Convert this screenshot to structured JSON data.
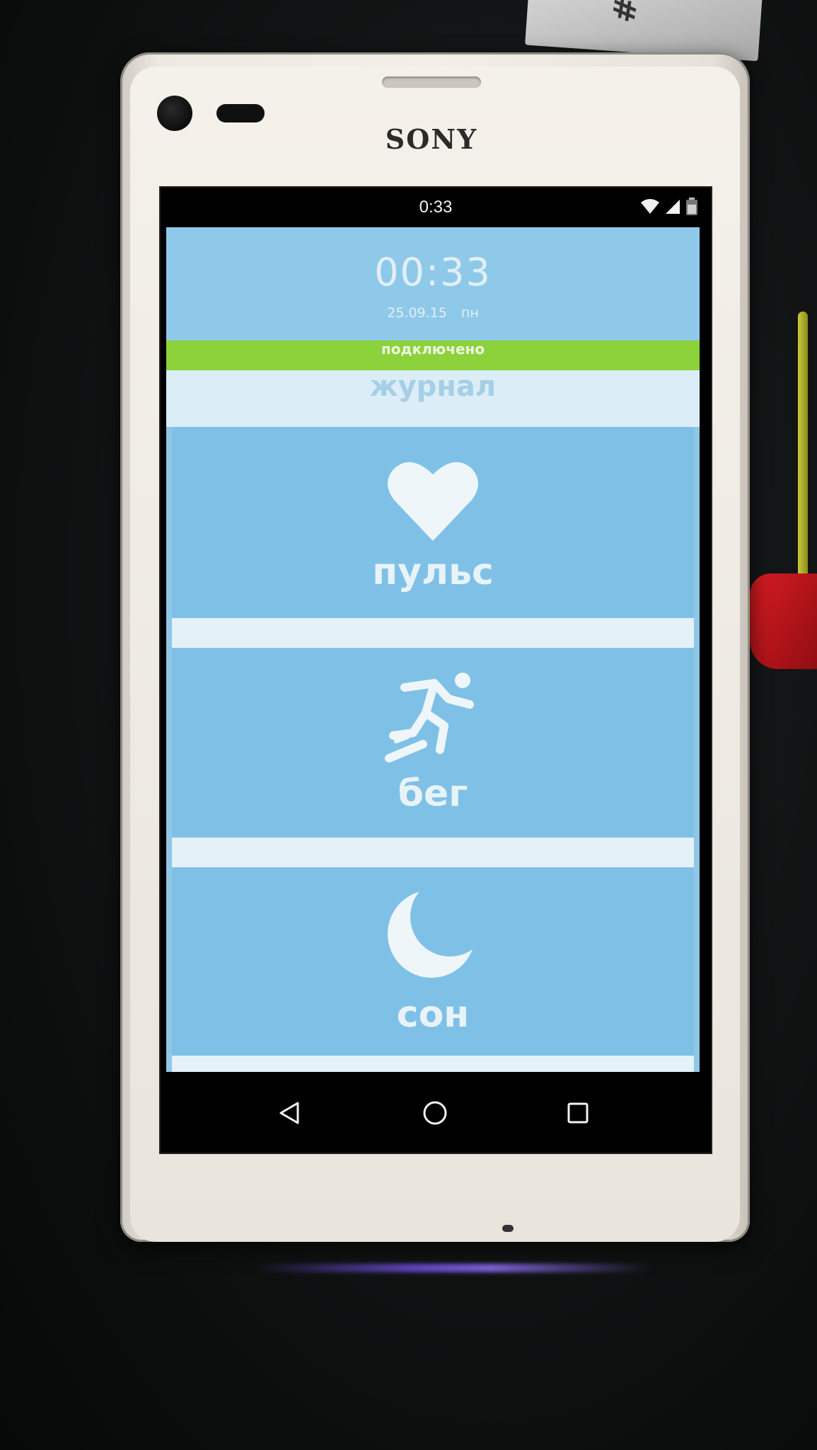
{
  "status_bar": {
    "time": "0:33",
    "icons": [
      "wifi-icon",
      "cell-signal-icon",
      "battery-icon"
    ]
  },
  "clock": {
    "time": "00:33",
    "date": "25.09.15",
    "weekday": "пн"
  },
  "connection": {
    "label": "подключено",
    "color": "#8cd23a"
  },
  "log": {
    "label": "журнал"
  },
  "tiles": [
    {
      "id": "pulse",
      "label": "пульс",
      "icon": "heart-icon"
    },
    {
      "id": "run",
      "label": "бег",
      "icon": "running-person-icon"
    },
    {
      "id": "sleep",
      "label": "сон",
      "icon": "crescent-moon-icon"
    }
  ],
  "navigation": {
    "buttons": [
      "back-icon",
      "home-icon",
      "recent-apps-icon"
    ]
  },
  "device": {
    "brand": "SONY"
  },
  "colors": {
    "tile_blue": "#7fc1e6",
    "divider": "#e4f1f8",
    "connected_green": "#8cd23a"
  }
}
